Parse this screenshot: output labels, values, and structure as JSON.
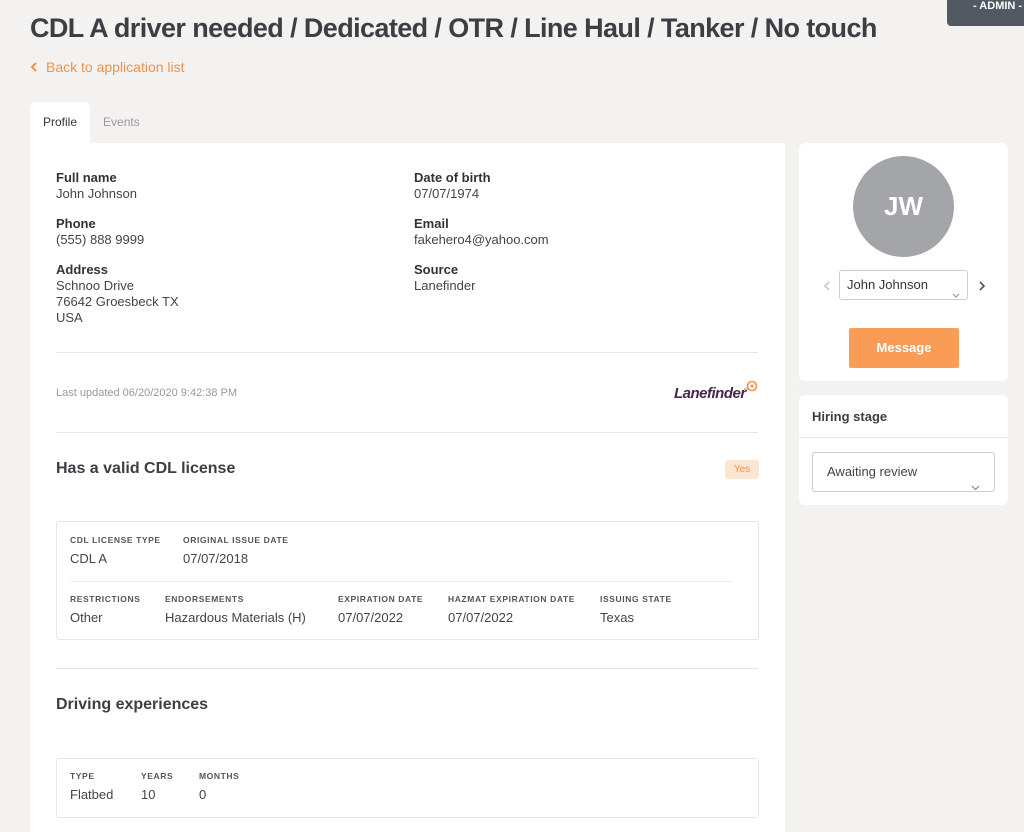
{
  "header": {
    "admin_badge": "- ADMIN -",
    "title": "CDL A driver needed / Dedicated / OTR / Line Haul / Tanker / No touch",
    "back_link": "Back to application list"
  },
  "tabs": [
    {
      "label": "Profile",
      "active": true
    },
    {
      "label": "Events",
      "active": false
    }
  ],
  "profile": {
    "full_name": {
      "label": "Full name",
      "value": "John Johnson"
    },
    "dob": {
      "label": "Date of birth",
      "value": "07/07/1974"
    },
    "phone": {
      "label": "Phone",
      "value": "(555) 888 9999"
    },
    "email": {
      "label": "Email",
      "value": "fakehero4@yahoo.com"
    },
    "address": {
      "label": "Address",
      "line1": "Schnoo Drive",
      "line2": "76642 Groesbeck TX",
      "line3": "USA"
    },
    "source": {
      "label": "Source",
      "value": "Lanefinder"
    },
    "last_updated": "Last updated 06/20/2020 9:42:38 PM",
    "logo_text": "Lanefinder"
  },
  "cdl": {
    "title": "Has a valid CDL license",
    "badge": "Yes",
    "license_type": {
      "label": "CDL LICENSE TYPE",
      "value": "CDL A"
    },
    "issue_date": {
      "label": "ORIGINAL ISSUE DATE",
      "value": "07/07/2018"
    },
    "restrictions": {
      "label": "RESTRICTIONS",
      "value": "Other"
    },
    "endorsements": {
      "label": "ENDORSEMENTS",
      "value": "Hazardous Materials (H)"
    },
    "expiration": {
      "label": "EXPIRATION DATE",
      "value": "07/07/2022"
    },
    "hazmat_expiration": {
      "label": "HAZMAT EXPIRATION DATE",
      "value": "07/07/2022"
    },
    "issuing_state": {
      "label": "ISSUING STATE",
      "value": "Texas"
    }
  },
  "experience": {
    "title": "Driving experiences",
    "type": {
      "label": "TYPE",
      "value": "Flatbed"
    },
    "years": {
      "label": "YEARS",
      "value": "10"
    },
    "months": {
      "label": "MONTHS",
      "value": "0"
    }
  },
  "sidebar": {
    "avatar_initials": "JW",
    "applicant_select": "John Johnson",
    "message_button": "Message",
    "hiring_stage_title": "Hiring stage",
    "hiring_stage_value": "Awaiting review"
  },
  "colors": {
    "accent": "#f89c56",
    "link": "#f0924a",
    "logo": "#4a2548",
    "avatar": "#a3a5a9"
  },
  "icons": [
    "chevron-left-icon",
    "chevron-right-icon",
    "chevron-down-icon",
    "location-pin-icon"
  ]
}
